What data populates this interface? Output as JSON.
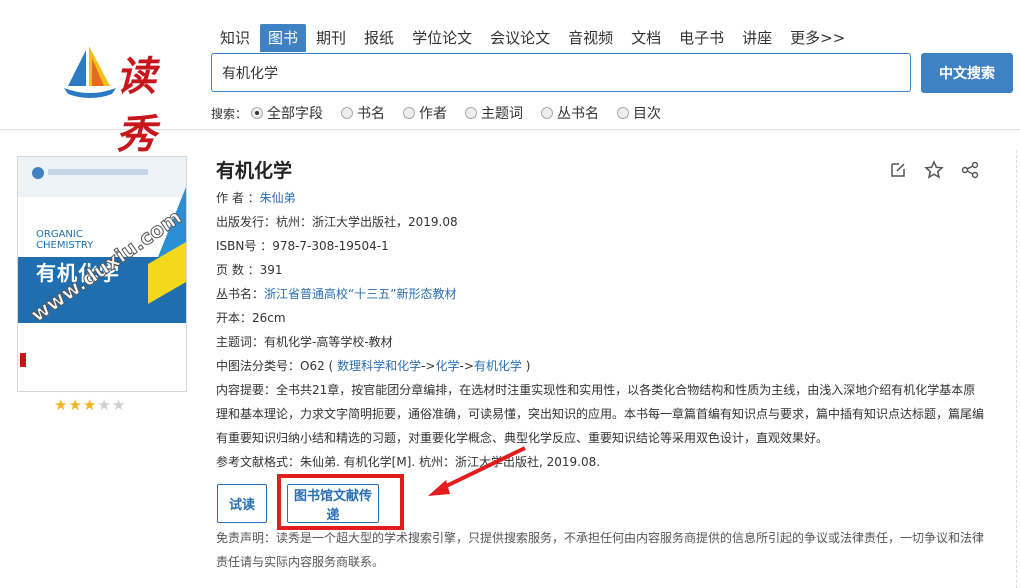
{
  "header": {
    "logo_text": "读秀",
    "nav_tabs": [
      {
        "label": "知识",
        "active": false
      },
      {
        "label": "图书",
        "active": true
      },
      {
        "label": "期刊",
        "active": false
      },
      {
        "label": "报纸",
        "active": false
      },
      {
        "label": "学位论文",
        "active": false
      },
      {
        "label": "会议论文",
        "active": false
      },
      {
        "label": "音视频",
        "active": false
      },
      {
        "label": "文档",
        "active": false
      },
      {
        "label": "电子书",
        "active": false
      },
      {
        "label": "讲座",
        "active": false
      },
      {
        "label": "更多>>",
        "active": false
      }
    ],
    "search_value": "有机化学",
    "search_button": "中文搜索",
    "scope_prefix": "搜索：",
    "scope_options": [
      {
        "label": "全部字段",
        "checked": true
      },
      {
        "label": "书名",
        "checked": false
      },
      {
        "label": "作者",
        "checked": false
      },
      {
        "label": "主题词",
        "checked": false
      },
      {
        "label": "丛书名",
        "checked": false
      },
      {
        "label": "目次",
        "checked": false
      }
    ]
  },
  "book": {
    "cover": {
      "en_title_line1": "ORGANIC",
      "en_title_line2": "CHEMISTRY",
      "cn_title": "有机化学",
      "watermark": "www.duxiu.com"
    },
    "rating": {
      "value": 3,
      "max": 5
    },
    "title": "有机化学",
    "author_label": "作 者 ：",
    "author": "朱仙弟",
    "publish_label": "出版发行：",
    "publish": "杭州：浙江大学出版社，2019.08",
    "isbn_label": "ISBN号 ：",
    "isbn": "978-7-308-19504-1",
    "pages_label": "页 数 ：",
    "pages": "391",
    "series_label": "丛书名：",
    "series": "浙江省普通高校“十三五”新形态教材",
    "format_label": "开本：",
    "format": "26cm",
    "subject_label": "主题词：",
    "subject": "有机化学-高等学校-教材",
    "class_label": "中图法分类号：",
    "class_code": "O62 (",
    "class_link1": "数理科学和化学",
    "class_sep1": "->",
    "class_link2": "化学",
    "class_sep2": "->",
    "class_link3": "有机化学",
    "class_close": ")",
    "summary_label": "内容提要：",
    "summary": "全书共21章，按官能团分章编排，在选材时注重实现性和实用性，以各类化合物结构和性质为主线，由浅入深地介绍有机化学基本原理和基本理论，力求文字简明扼要，通俗准确，可读易懂，突出知识的应用。本书每一章篇首编有知识点与要求，篇中插有知识点达标题，篇尾编有重要知识归纳小结和精选的习题，对重要化学概念、典型化学反应、重要知识结论等采用双色设计，直观效果好。",
    "citation_label": "参考文献格式：",
    "citation": "朱仙弟. 有机化学[M]. 杭州：浙江大学出版社, 2019.08.",
    "btn_read": "试读",
    "btn_library": "图书馆文献传递",
    "disclaimer": "免责声明：读秀是一个超大型的学术搜索引擎，只提供搜索服务，不承担任何由内容服务商提供的信息所引起的争议或法律责任，一切争议和法律责任请与实际内容服务商联系。"
  },
  "colors": {
    "accent": "#3e82c4",
    "link": "#2a6fb4",
    "highlight": "#e31d1d",
    "star": "#f3b322"
  }
}
